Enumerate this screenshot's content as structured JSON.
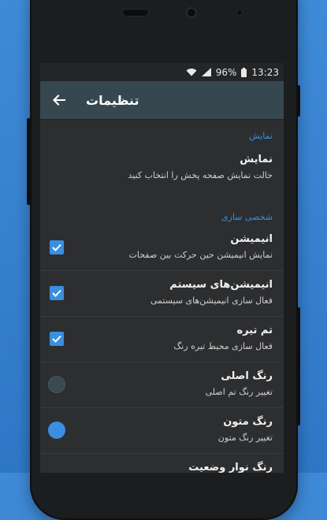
{
  "status": {
    "time": "13:23",
    "battery": "96%"
  },
  "app": {
    "title": "تنظیمات"
  },
  "sections": {
    "display_header": "نمایش",
    "display": {
      "title": "نمایش",
      "subtitle": "حالت نمایش صفحه پخش را انتخاب کنید"
    },
    "personalize_header": "شخصی سازی",
    "animation": {
      "title": "انیمیشن",
      "subtitle": "نمایش انیمیشن حین حرکت بین صفحات",
      "checked": true
    },
    "system_anim": {
      "title": "انیمیشن‌های سیستم",
      "subtitle": "فعال سازی انیمیشن‌های سیستمی",
      "checked": true
    },
    "dark_theme": {
      "title": "تم تیره",
      "subtitle": "فعال سازی محیط تیره رنگ",
      "checked": true
    },
    "primary_color": {
      "title": "رنگ اصلی",
      "subtitle": "تغییر رنگ تم اصلی",
      "swatch": "#3a4a53"
    },
    "text_color": {
      "title": "رنگ متون",
      "subtitle": "تغییر رنگ متون",
      "swatch": "#3b8fe0"
    },
    "statusbar_color": {
      "title": "رنگ نوار وضعیت"
    }
  },
  "colors": {
    "accent": "#3b8fe0",
    "appbar": "#37474f",
    "background": "#2d2e30"
  }
}
